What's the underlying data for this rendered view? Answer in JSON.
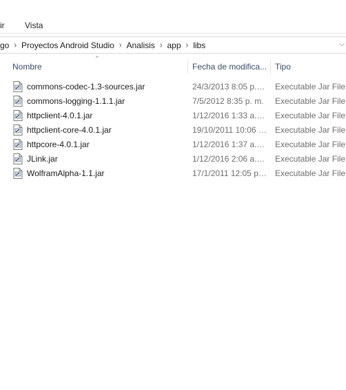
{
  "menu": {
    "items": [
      "ir",
      "Vista"
    ]
  },
  "address": {
    "crumbs": [
      "go",
      "Proyectos Android Studio",
      "Analisis",
      "app",
      "libs"
    ]
  },
  "columns": {
    "name": "Nombre",
    "date": "Fecha de modifica...",
    "type": "Tipo"
  },
  "files": [
    {
      "name": "commons-codec-1.3-sources.jar",
      "date": "24/3/2013 8:05 p. m.",
      "type": "Executable Jar File"
    },
    {
      "name": "commons-logging-1.1.1.jar",
      "date": "7/5/2012 8:35 p. m.",
      "type": "Executable Jar File"
    },
    {
      "name": "httpclient-4.0.1.jar",
      "date": "1/12/2016 1:33 a. m.",
      "type": "Executable Jar File"
    },
    {
      "name": "httpclient-core-4.0.1.jar",
      "date": "19/10/2011 10:06 a...",
      "type": "Executable Jar File"
    },
    {
      "name": "httpcore-4.0.1.jar",
      "date": "1/12/2016 1:37 a. m.",
      "type": "Executable Jar File"
    },
    {
      "name": "JLink.jar",
      "date": "1/12/2016 2:06 a. m.",
      "type": "Executable Jar File"
    },
    {
      "name": "WolframAlpha-1.1.jar",
      "date": "17/1/2011 12:05 p....",
      "type": "Executable Jar File"
    }
  ],
  "icons": {
    "file": "jar-file-icon",
    "separator": "chevron-right-icon",
    "dropdown": "chevron-down-icon",
    "sort": "sort-up-icon"
  }
}
